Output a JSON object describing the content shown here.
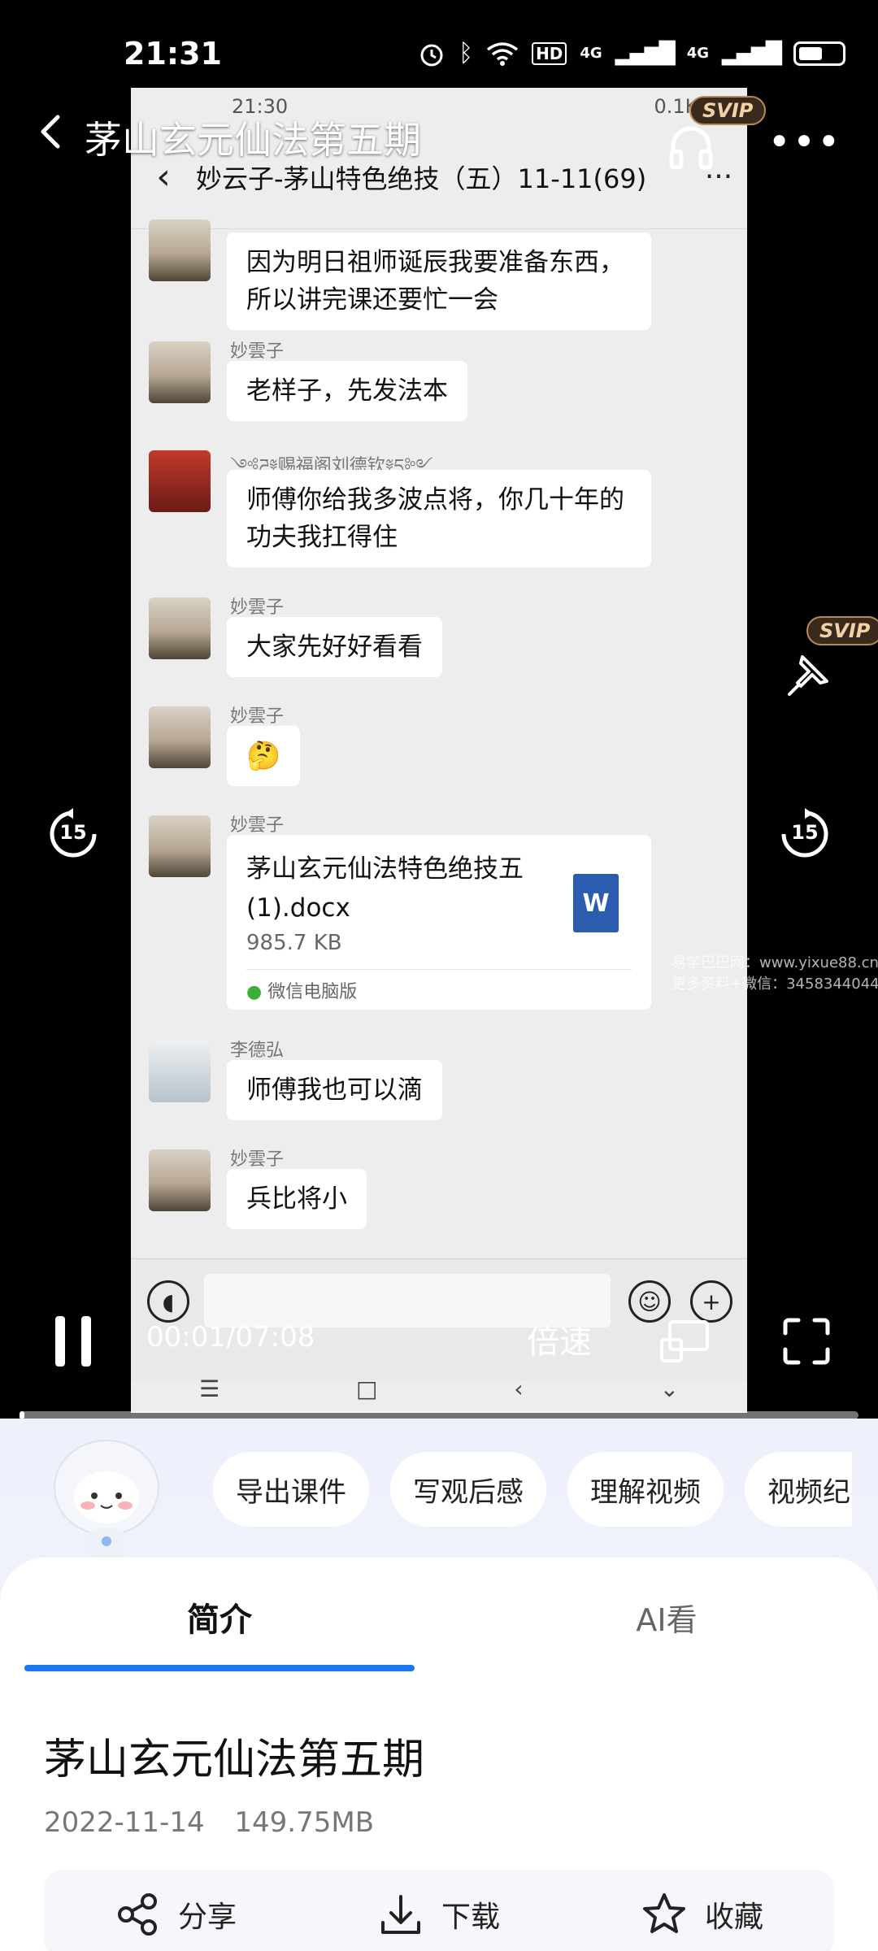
{
  "status_bar": {
    "time": "21:31",
    "net_labels": [
      "HD",
      "4G",
      "4G"
    ],
    "battery_level": 0.62
  },
  "player": {
    "title": "茅山玄元仙法第五期",
    "svip_badge": "SVIP",
    "time_display": "00:01/07:08",
    "speed_label": "倍速",
    "skip_back_label": "15",
    "skip_forward_label": "15",
    "progress": 0.002,
    "watermark": [
      "易学巴巴网：www.yixue88.cn",
      "更多资料+微信：3458344044"
    ]
  },
  "video_content": {
    "inner_status_time": "21:30",
    "inner_status_speed": "0.1K/s",
    "chat_title": "妙云子-茅山特色绝技（五）11-11(69)",
    "messages": [
      {
        "sender": "",
        "text": "因为明日祖师诞辰我要准备东西，所以讲完课还要忙一会"
      },
      {
        "sender": "妙雲子",
        "text": "老样子，先发法本"
      },
      {
        "sender": "༺ཌ༈赐福阁刘德钦༈ད༻",
        "text": "师傅你给我多波点将，你几十年的功夫我扛得住"
      },
      {
        "sender": "妙雲子",
        "text": "大家先好好看看"
      },
      {
        "sender": "妙雲子",
        "text": "🤔"
      },
      {
        "sender": "妙雲子",
        "file": {
          "name": "茅山玄元仙法特色绝技五(1).docx",
          "size": "985.7 KB",
          "source": "微信电脑版",
          "icon_letter": "W"
        }
      },
      {
        "sender": "李德弘",
        "text": "师傅我也可以滴"
      },
      {
        "sender": "妙雲子",
        "text": "兵比将小"
      }
    ]
  },
  "chips": [
    "导出课件",
    "写观后感",
    "理解视频",
    "视频纪要"
  ],
  "tabs": {
    "intro": "简介",
    "ai": "AI看"
  },
  "info": {
    "title": "茅山玄元仙法第五期",
    "date": "2022-11-14",
    "size": "149.75MB"
  },
  "actions": {
    "share": "分享",
    "download": "下载",
    "favorite": "收藏"
  },
  "colors": {
    "accent": "#1b78f2",
    "svip_gold": "#f1d2a4"
  }
}
